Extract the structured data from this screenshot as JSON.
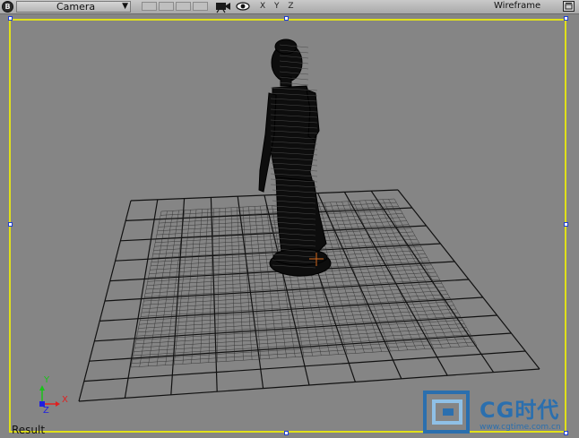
{
  "toolbar": {
    "badge": "B",
    "camera_label": "Camera",
    "camera_arrow": "▼",
    "axes": [
      "X",
      "Y",
      "Z"
    ],
    "view_mode": "Wireframe"
  },
  "viewport": {
    "result_label": "Result",
    "gizmo": {
      "y": "Y",
      "x": "X",
      "z": "Z"
    },
    "colors": {
      "frame": "#e0e01a",
      "handle_border": "#1f3fd0",
      "background": "#858585"
    }
  },
  "watermark": {
    "brand": "CG时代",
    "url": "www.cgtime.com.cn"
  },
  "icons": [
    "badge-icon",
    "camera-icon",
    "eye-icon",
    "layout-icon",
    "origin-marker-icon"
  ]
}
